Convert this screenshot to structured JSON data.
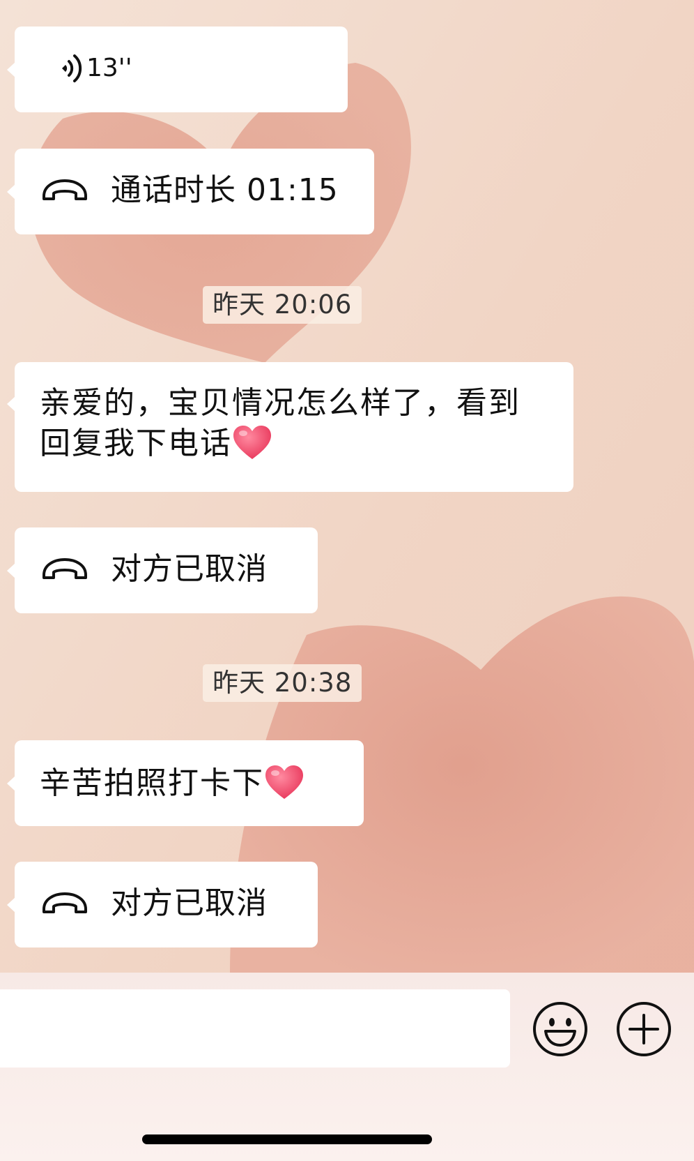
{
  "messages": {
    "voice": {
      "duration": "13''"
    },
    "call_1": {
      "text": "通话时长 01:15"
    },
    "timestamp_1": "昨天 20:06",
    "text_1": {
      "text": "亲爱的，宝贝情况怎么样了，看到回复我下电话",
      "emoji": "heart"
    },
    "call_2": {
      "text": "对方已取消"
    },
    "timestamp_2": "昨天 20:38",
    "text_2": {
      "text": "辛苦拍照打卡下",
      "emoji": "heart"
    },
    "call_3": {
      "text": "对方已取消"
    }
  },
  "input_bar": {
    "emoji_button_icon": "smiley-icon",
    "more_button_icon": "plus-circle-icon"
  },
  "colors": {
    "bubble": "#ffffff",
    "background": "#f3dccd",
    "heart_emoji": "#f04a6a"
  }
}
